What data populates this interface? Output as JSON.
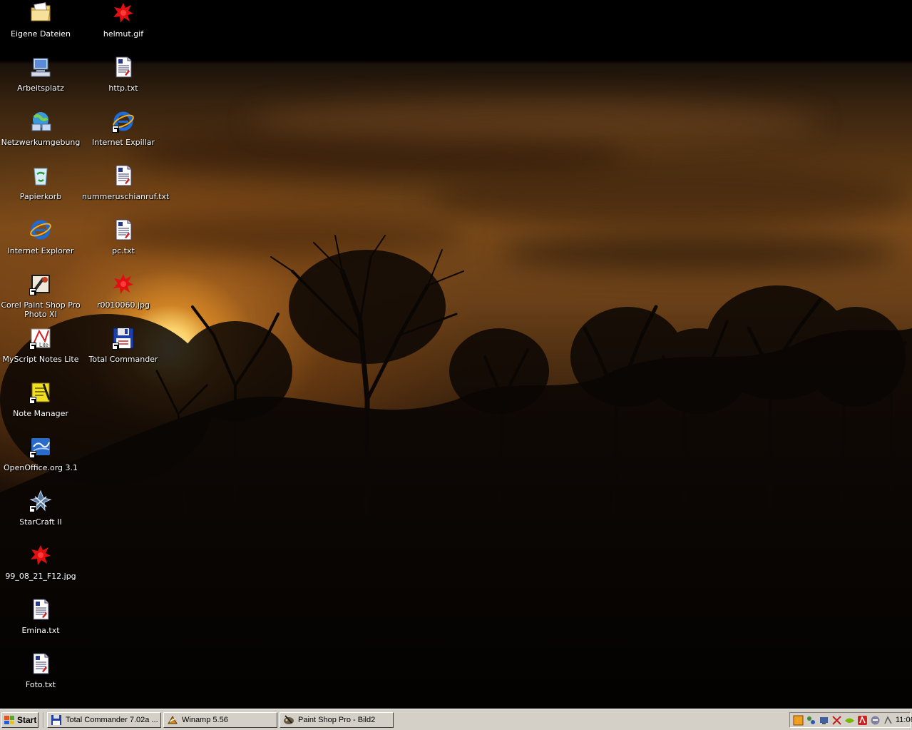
{
  "desktop": {
    "icons_col1": [
      {
        "label": "Eigene Dateien",
        "icon": "folder-documents-icon"
      },
      {
        "label": "Arbeitsplatz",
        "icon": "my-computer-icon"
      },
      {
        "label": "Netzwerkumgebung",
        "icon": "network-places-icon"
      },
      {
        "label": "Papierkorb",
        "icon": "recycle-bin-icon"
      },
      {
        "label": "Internet Explorer",
        "icon": "internet-explorer-icon"
      },
      {
        "label": "Corel Paint Shop Pro Photo XI",
        "icon": "paint-shop-pro-icon"
      },
      {
        "label": "MyScript Notes Lite",
        "icon": "myscript-notes-icon"
      },
      {
        "label": "Note Manager",
        "icon": "note-manager-icon"
      },
      {
        "label": "OpenOffice.org 3.1",
        "icon": "openoffice-icon"
      },
      {
        "label": "StarCraft II",
        "icon": "starcraft-icon"
      },
      {
        "label": "99_08_21_F12.jpg",
        "icon": "image-file-icon"
      },
      {
        "label": "Emina.txt",
        "icon": "text-file-icon"
      },
      {
        "label": "Foto.txt",
        "icon": "text-file-icon"
      }
    ],
    "icons_col2": [
      {
        "label": "helmut.gif",
        "icon": "image-file-icon"
      },
      {
        "label": "http.txt",
        "icon": "text-file-icon"
      },
      {
        "label": "Internet Expillar",
        "icon": "internet-explorer-icon"
      },
      {
        "label": "nummeruschianruf.txt",
        "icon": "text-file-icon"
      },
      {
        "label": "pc.txt",
        "icon": "text-file-icon"
      },
      {
        "label": "r0010060.jpg",
        "icon": "image-file-icon"
      },
      {
        "label": "Total Commander",
        "icon": "total-commander-icon"
      }
    ]
  },
  "taskbar": {
    "start_label": "Start",
    "tasks": [
      {
        "label": "Total Commander 7.02a ...",
        "icon": "floppy-disk-icon"
      },
      {
        "label": "Winamp 5.56",
        "icon": "winamp-icon"
      },
      {
        "label": "Paint Shop Pro - Bild2",
        "icon": "paint-shop-pro-icon"
      }
    ],
    "tray_icons": [
      "tray-icon-1",
      "tray-icon-2",
      "tray-icon-3",
      "tray-icon-4",
      "tray-icon-5",
      "tray-icon-6",
      "tray-icon-7",
      "tray-icon-8"
    ],
    "clock": "11:06"
  },
  "colors": {
    "taskbar_bg": "#d4d0c8",
    "icon_text": "#ffffff"
  }
}
